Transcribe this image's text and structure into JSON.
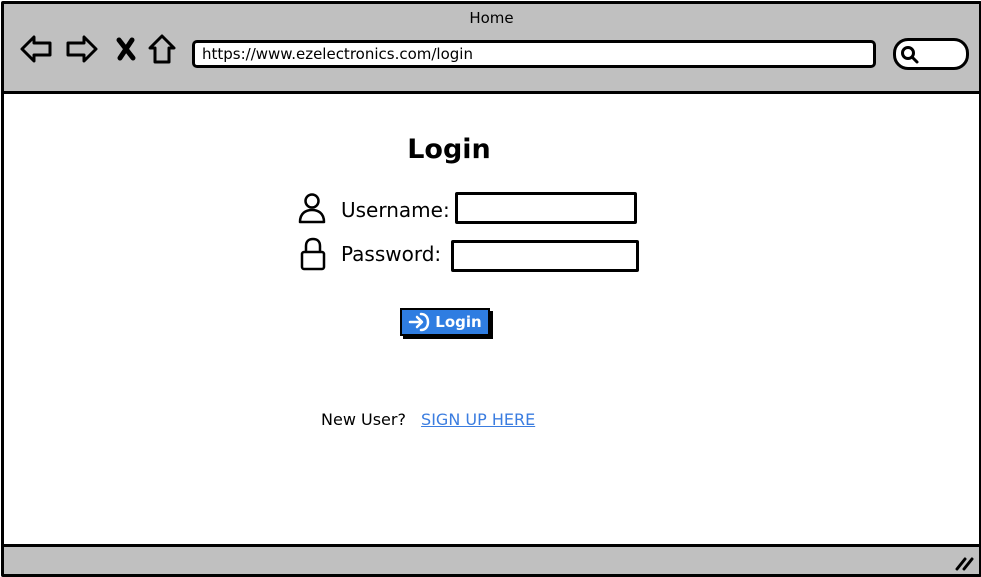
{
  "window": {
    "title": "Home"
  },
  "browser": {
    "url": "https://www.ezelectronics.com/login",
    "nav_icons": [
      "back-arrow-icon",
      "forward-arrow-icon",
      "close-x-icon",
      "home-icon"
    ],
    "search_icon": "search-icon"
  },
  "login": {
    "title": "Login",
    "username_label": "Username:",
    "password_label": "Password:",
    "username_value": "",
    "password_value": "",
    "username_icon": "user-icon",
    "password_icon": "lock-icon",
    "button_label": "Login",
    "button_icon": "sign-in-arrow-icon"
  },
  "signup": {
    "prompt": "New User?",
    "link_text": "SIGN UP HERE"
  },
  "colors": {
    "chrome": "#c0c0c0",
    "button": "#2f7de1",
    "link": "#3b7de0",
    "border": "#000000"
  }
}
